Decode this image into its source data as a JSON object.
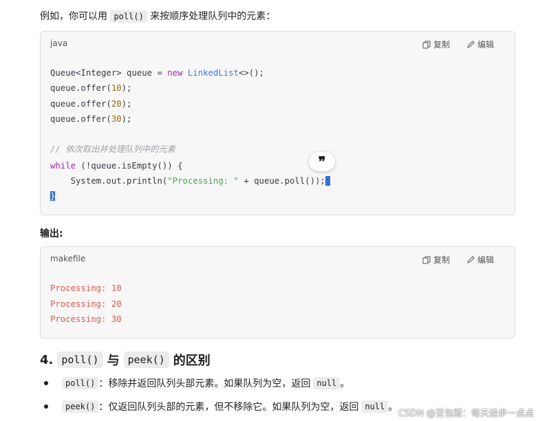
{
  "intro": {
    "prefix": "例如，你可以用",
    "code": "poll()",
    "suffix": "来按顺序处理队列中的元素："
  },
  "code_block_1": {
    "language": "java",
    "copy_label": "复制",
    "edit_label": "编辑",
    "lines": [
      "Queue<Integer> queue = new LinkedList<>();",
      "queue.offer(10);",
      "queue.offer(20);",
      "queue.offer(30);",
      "// 依次取出并处理队列中的元素",
      "while (!queue.isEmpty()) {",
      "    System.out.println(\"Processing: \" + queue.poll());",
      "}"
    ]
  },
  "quote_button": "❞",
  "output_heading": "输出:",
  "code_block_2": {
    "language": "makefile",
    "copy_label": "复制",
    "edit_label": "编辑",
    "lines": [
      "Processing: 10",
      "Processing: 20",
      "Processing: 30"
    ]
  },
  "section": {
    "number": "4.",
    "code1": "poll()",
    "connector": "与",
    "code2": "peek()",
    "suffix": "的区别"
  },
  "bullets": [
    {
      "code": "poll()",
      "text": "：移除并返回队列头部元素。如果队列为空，返回",
      "code2": "null",
      "end": "。"
    },
    {
      "code": "peek()",
      "text": "：仅返回队列头部的元素，但不移除它。如果队列为空，返回",
      "code2": "null",
      "end": "。"
    }
  ],
  "watermark": "CSDN @豆包版：每天进步一点点"
}
